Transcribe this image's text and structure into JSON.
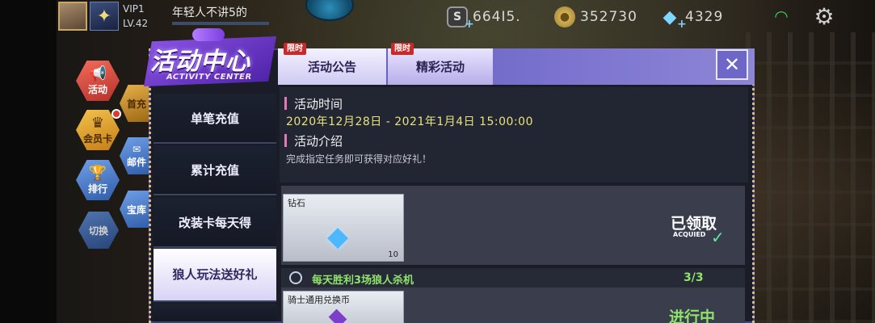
{
  "hud": {
    "vip": "VIP1",
    "level": "LV.42",
    "player_name": "年轻人不讲5的",
    "currency_s": "664I5.",
    "gold": "352730",
    "diamonds": "4329"
  },
  "side_menu": {
    "activity": "活动",
    "vip_card": "会员卡",
    "rank": "排行",
    "switch": "切换",
    "partial_first_recharge": "首充",
    "partial_mail": "邮件",
    "partial_treasure": "宝库"
  },
  "logo": {
    "title": "活动中心",
    "subtitle": "ACTIVITY CENTER"
  },
  "tabs": [
    {
      "label": "活动公告",
      "tag": "限时"
    },
    {
      "label": "精彩活动",
      "tag": "限时"
    }
  ],
  "close_label": "✕",
  "categories": [
    {
      "label": "单笔充值"
    },
    {
      "label": "累计充值"
    },
    {
      "label": "改装卡每天得"
    },
    {
      "label": "狼人玩法送好礼"
    }
  ],
  "info": {
    "time_label": "活动时间",
    "time_value": "2020年12月28日 - 2021年1月4日 15:00:00",
    "intro_label": "活动介绍",
    "intro_text": "完成指定任务即可获得对应好礼！"
  },
  "rewards": [
    {
      "item_name": "钻石",
      "item_count": "10",
      "status": "已领取",
      "status_en": "ACQUIED"
    },
    {
      "task": "每天胜利3场狼人杀机",
      "progress": "3/3",
      "item_name": "骑士通用兑换币",
      "status": "进行中"
    }
  ],
  "colors": {
    "accent_purple": "#6f67c8",
    "progress_green": "#8fe36b",
    "time_yellow": "#e8e37a",
    "tag_red": "#c52b2b"
  }
}
